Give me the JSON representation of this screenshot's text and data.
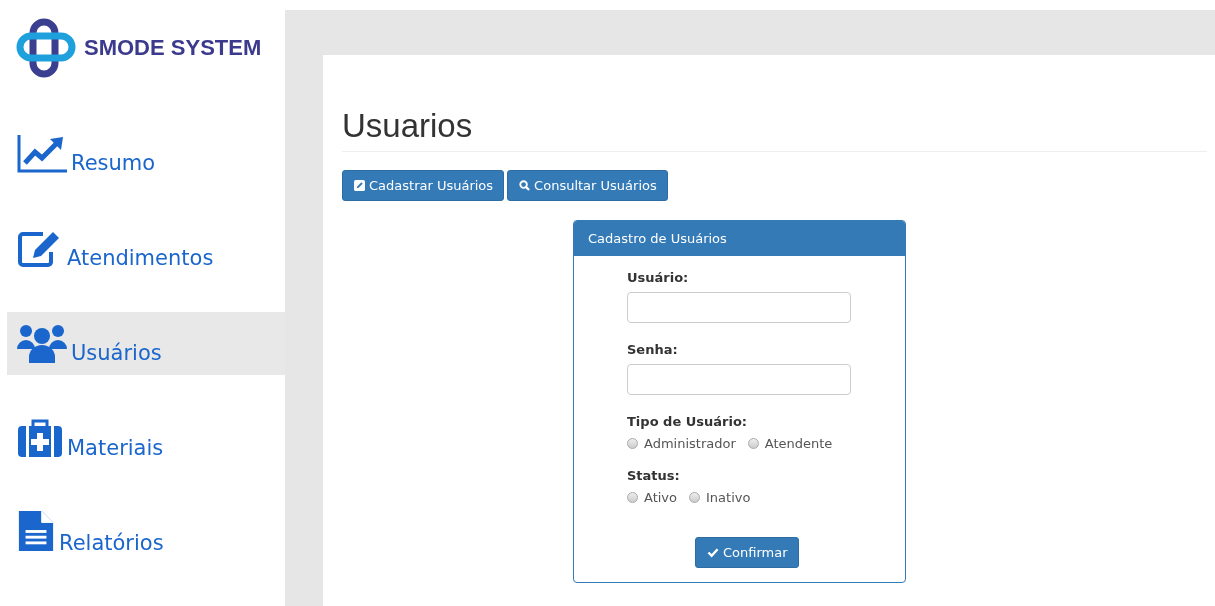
{
  "brand": {
    "name": "SMODE SYSTEM"
  },
  "sidebar": {
    "items": [
      {
        "label": "Resumo",
        "selected": false
      },
      {
        "label": "Atendimentos",
        "selected": false
      },
      {
        "label": "Usuários",
        "selected": true
      },
      {
        "label": "Materiais",
        "selected": false
      },
      {
        "label": "Relatórios",
        "selected": false
      }
    ]
  },
  "page": {
    "title": "Usuarios",
    "actions": [
      {
        "label": "Cadastrar Usuários"
      },
      {
        "label": "Consultar Usuários"
      }
    ]
  },
  "form": {
    "title": "Cadastro de Usuários",
    "fields": [
      {
        "label": "Usuário:"
      },
      {
        "label": "Senha:"
      }
    ],
    "radio_groups": [
      {
        "label": "Tipo de Usuário:",
        "options": [
          {
            "label": "Administrador",
            "selected": false
          },
          {
            "label": "Atendente",
            "selected": false
          }
        ]
      },
      {
        "label": "Status:",
        "options": [
          {
            "label": "Ativo",
            "selected": false
          },
          {
            "label": "Inativo",
            "selected": false
          }
        ]
      }
    ],
    "submit": "Confirmar"
  }
}
